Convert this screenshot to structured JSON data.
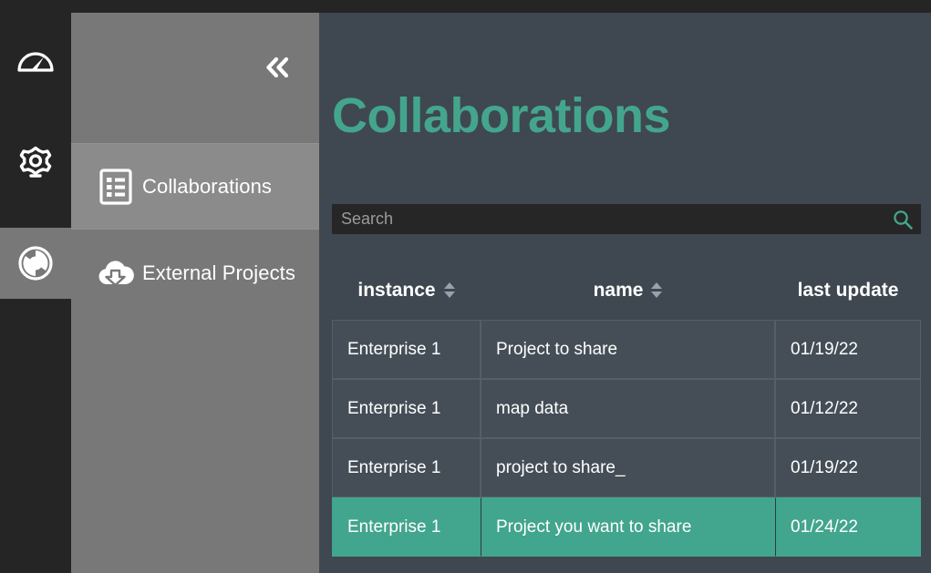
{
  "theme": {
    "accent": "#44a58d",
    "row_selected_bg": "#42a58d",
    "content_bg": "#3f4750",
    "nav_panel_bg": "#787878",
    "rail_bg": "#252525",
    "cell_bg": "#454e57",
    "cell_border": "#555f69"
  },
  "rail": {
    "items": [
      {
        "icon": "gauge-icon",
        "name": "dashboard",
        "active": false
      },
      {
        "icon": "gear-icon",
        "name": "settings",
        "active": false
      },
      {
        "icon": "collaboration-sync-icon",
        "name": "collaboration",
        "active": true
      }
    ]
  },
  "nav_panel": {
    "collapse_icon": "double-chevron-left-icon",
    "items": [
      {
        "label": "Collaborations",
        "icon": "list-document-icon",
        "selected": true
      },
      {
        "label": "External Projects",
        "icon": "cloud-download-icon",
        "selected": false
      }
    ]
  },
  "main": {
    "title": "Collaborations",
    "search": {
      "placeholder": "Search",
      "value": "",
      "icon": "search-icon"
    },
    "table": {
      "columns": [
        {
          "label": "instance",
          "sortable": true
        },
        {
          "label": "name",
          "sortable": true
        },
        {
          "label": "last update",
          "sortable": false
        }
      ],
      "rows": [
        {
          "instance": "Enterprise 1",
          "name": "Project to share",
          "last_update": "01/19/22",
          "selected": false
        },
        {
          "instance": "Enterprise 1",
          "name": "map data",
          "last_update": "01/12/22",
          "selected": false
        },
        {
          "instance": "Enterprise 1",
          "name": "project to share_",
          "last_update": "01/19/22",
          "selected": false
        },
        {
          "instance": "Enterprise 1",
          "name": "Project you want to share",
          "last_update": "01/24/22",
          "selected": true
        }
      ]
    }
  }
}
